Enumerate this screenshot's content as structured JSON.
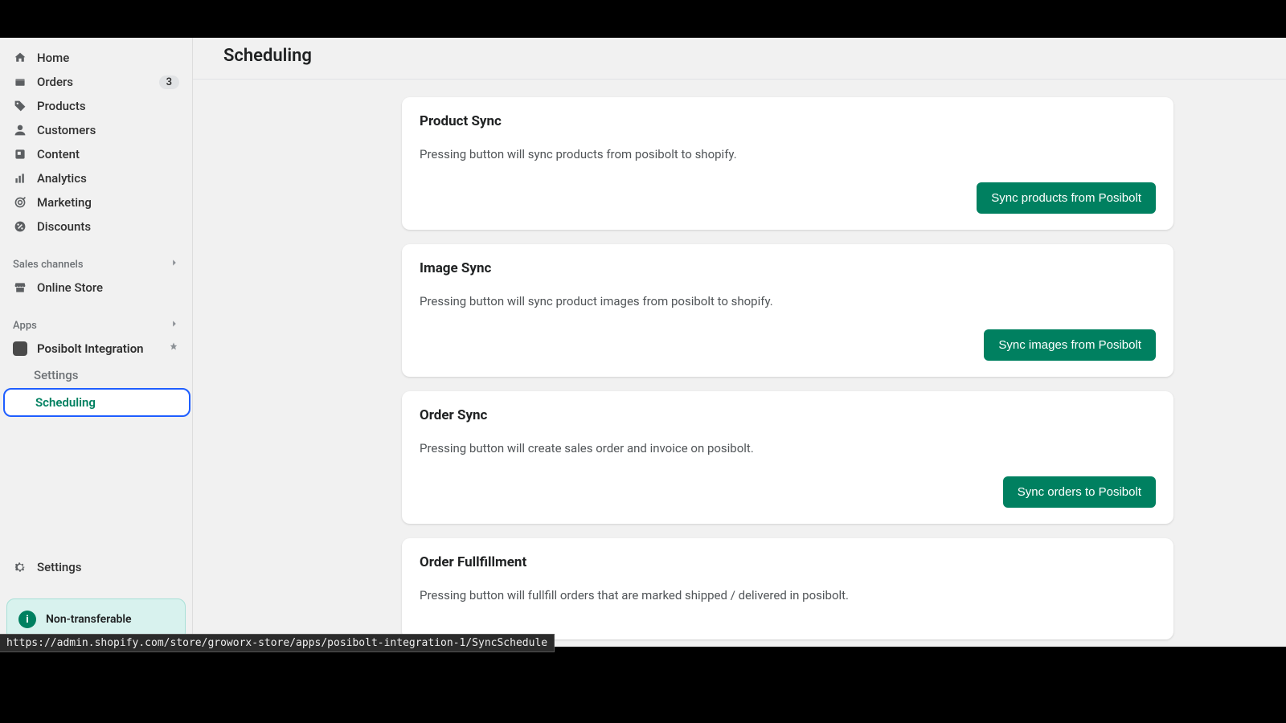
{
  "nav": {
    "items": [
      {
        "label": "Home"
      },
      {
        "label": "Orders",
        "badge": "3"
      },
      {
        "label": "Products"
      },
      {
        "label": "Customers"
      },
      {
        "label": "Content"
      },
      {
        "label": "Analytics"
      },
      {
        "label": "Marketing"
      },
      {
        "label": "Discounts"
      }
    ]
  },
  "sections": {
    "sales_channels": {
      "label": "Sales channels",
      "items": [
        {
          "label": "Online Store"
        }
      ]
    },
    "apps": {
      "label": "Apps",
      "items": [
        {
          "label": "Posibolt Integration",
          "subitems": [
            {
              "label": "Settings"
            },
            {
              "label": "Scheduling"
            }
          ]
        }
      ]
    }
  },
  "footer": {
    "settings": "Settings",
    "info": "Non-transferable"
  },
  "page": {
    "title": "Scheduling"
  },
  "cards": [
    {
      "title": "Product Sync",
      "desc": "Pressing button will sync products from posibolt to shopify.",
      "button": "Sync products from Posibolt"
    },
    {
      "title": "Image Sync",
      "desc": "Pressing button will sync product images from posibolt to shopify.",
      "button": "Sync images from Posibolt"
    },
    {
      "title": "Order Sync",
      "desc": "Pressing button will create sales order and invoice on posibolt.",
      "button": "Sync orders to Posibolt"
    },
    {
      "title": "Order Fullfillment",
      "desc": "Pressing button will fullfill orders that are marked shipped / delivered in posibolt.",
      "button": ""
    }
  ],
  "status_url": "https://admin.shopify.com/store/groworx-store/apps/posibolt-integration-1/SyncSchedule"
}
